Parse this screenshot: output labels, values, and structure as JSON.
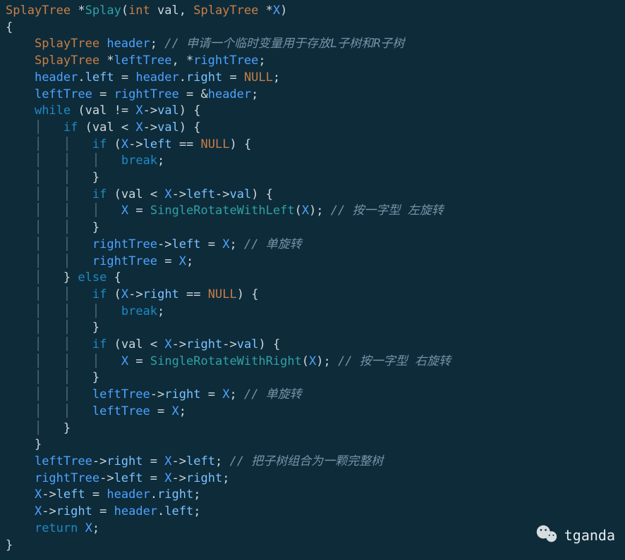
{
  "watermark": "tganda",
  "code": {
    "type_kw": "SplayTree",
    "int_kw": "int",
    "star": "*",
    "fn_splay": "Splay",
    "fn_rotL": "SingleRotateWithLeft",
    "fn_rotR": "SingleRotateWithRight",
    "id_val": "val",
    "id_X": "X",
    "id_header": "header",
    "id_leftTree": "leftTree",
    "id_rightTree": "rightTree",
    "mb_left": "left",
    "mb_right": "right",
    "mb_val": "val",
    "null": "NULL",
    "kw_while": "while",
    "kw_if": "if",
    "kw_else": "else",
    "kw_break": "break",
    "kw_return": "return",
    "amp": "&",
    "cmt_alloc": "// 申请一个临时变量用于存放L子树和R子树",
    "cmt_rotL": "// 按一字型 左旋转",
    "cmt_rotR": "// 按一字型 右旋转",
    "cmt_single": "// 单旋转",
    "cmt_merge": "// 把子树组合为一颗完整树"
  }
}
